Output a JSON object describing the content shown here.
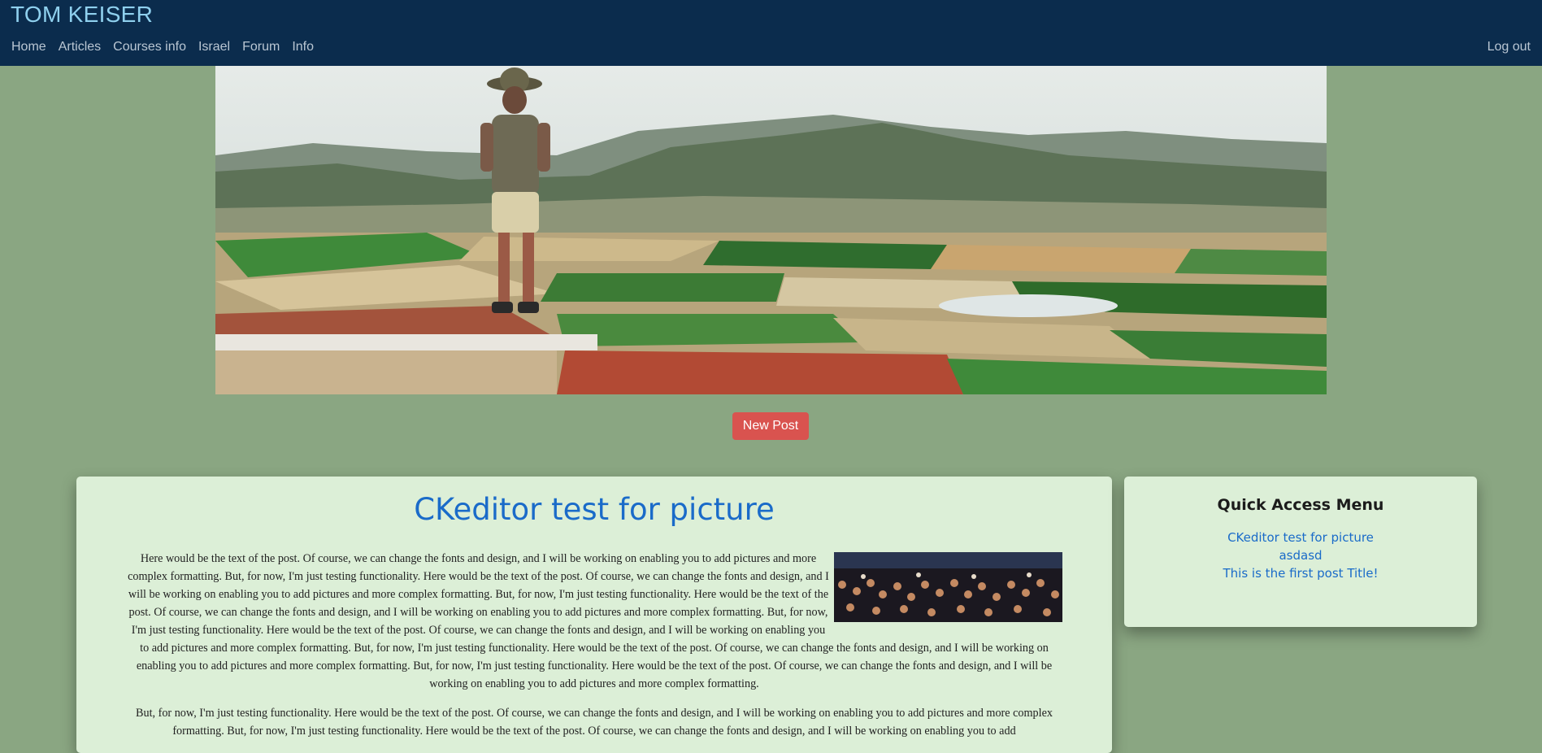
{
  "navbar": {
    "brand": "TOM KEISER",
    "links": [
      "Home",
      "Articles",
      "Courses info",
      "Israel",
      "Forum",
      "Info"
    ],
    "logout": "Log out"
  },
  "actions": {
    "new_post": "New Post"
  },
  "post": {
    "title": "CKeditor test for picture",
    "paragraphs": [
      "Here would be the text of the post. Of course, we can change the fonts and design, and I will be working on enabling you to add pictures and more complex formatting. But, for now, I'm just testing functionality. Here would be the text of the post. Of course, we can change the fonts and design, and I will be working on enabling you to add pictures and more complex formatting. But, for now, I'm just testing functionality. Here would be the text of the post. Of course, we can change the fonts and design, and I will be working on enabling you to add pictures and more complex formatting. But, for now, I'm just testing functionality. Here would be the text of the post. Of course, we can change the fonts and design, and I will be working on enabling you to add pictures and more complex formatting. But, for now, I'm just testing functionality. Here would be the text of the post. Of course, we can change the fonts and design, and I will be working on enabling you to add pictures and more complex formatting. But, for now, I'm just testing functionality. Here would be the text of the post. Of course, we can change the fonts and design, and I will be working on enabling you to add pictures and more complex formatting.",
      "But, for now, I'm just testing functionality. Here would be the text of the post. Of course, we can change the fonts and design, and I will be working on enabling you to add pictures and more complex formatting. But, for now, I'm just testing functionality. Here would be the text of the post. Of course, we can change the fonts and design, and I will be working on enabling you to add"
    ]
  },
  "quick_access": {
    "title": "Quick Access Menu",
    "links": [
      "CKeditor test for picture",
      "asdasd",
      "This is the first post Title!"
    ]
  },
  "colors": {
    "page_background": "#8aa682",
    "navbar_background": "#0b2c4d",
    "brand": "#8fd0ee",
    "card_background": "#dcefd7",
    "accent_link": "#1a6bc9",
    "new_post_button": "#d9534f"
  },
  "icons": []
}
